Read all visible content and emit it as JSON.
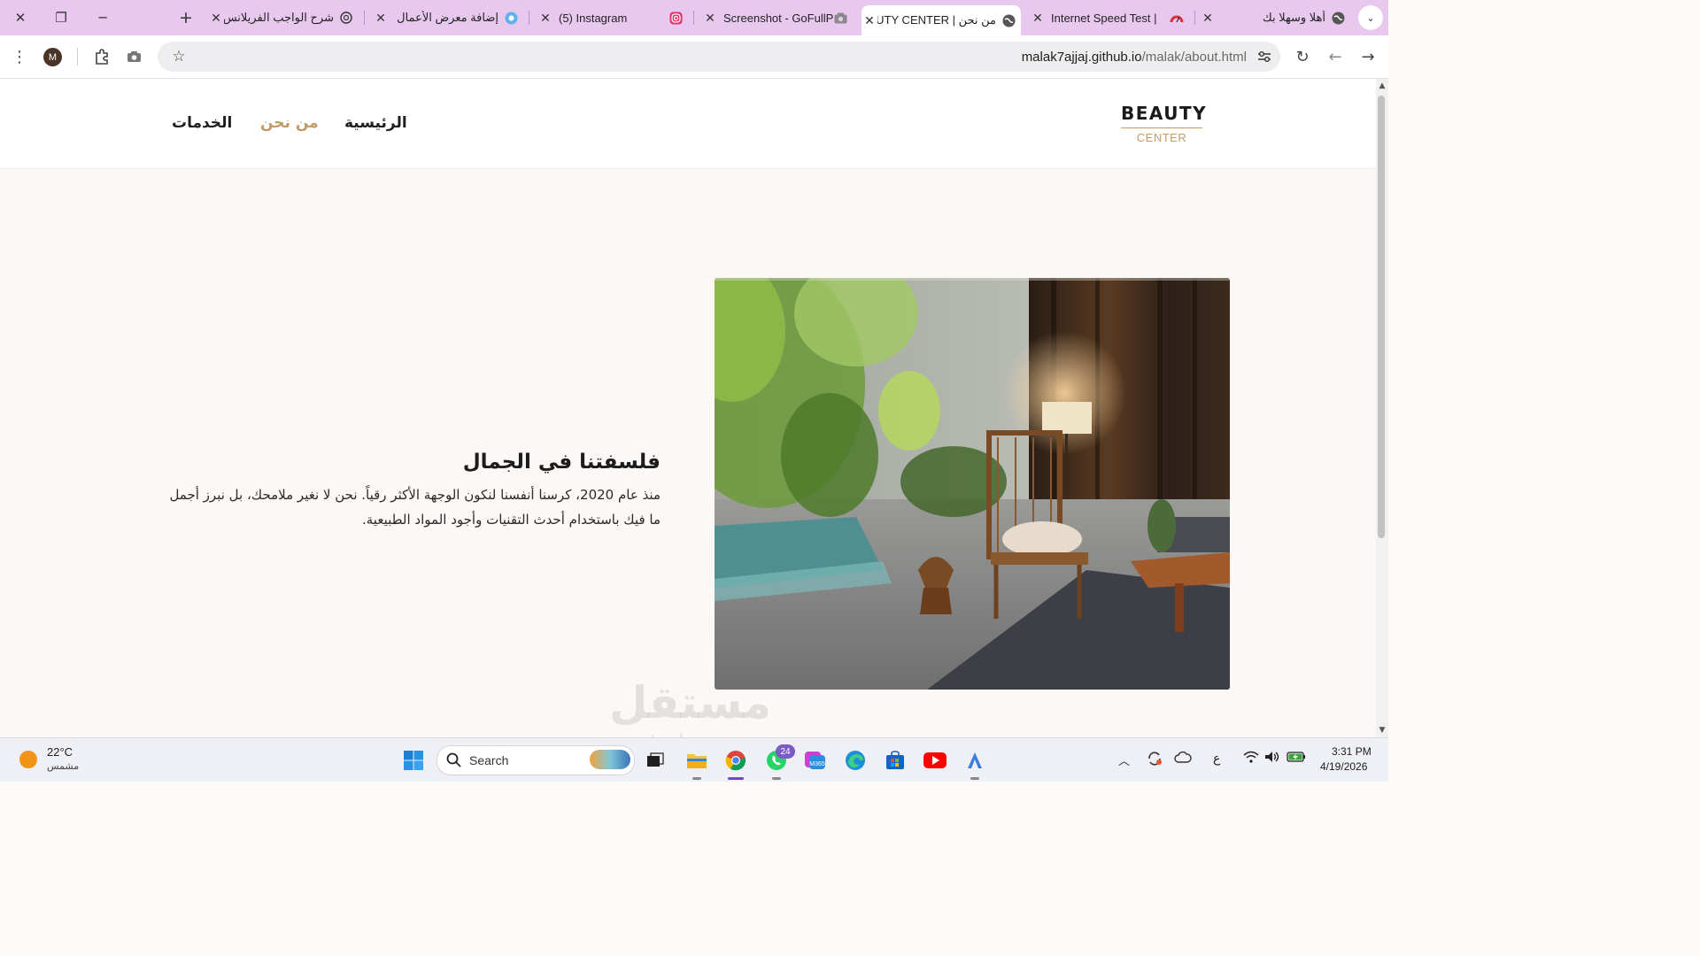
{
  "browser": {
    "tabs": [
      {
        "title": "أهلا وسهلا بك",
        "icon": "globe-icon",
        "active": false
      },
      {
        "title": "Internet Speed Test |",
        "icon": "speedometer-icon",
        "active": false
      },
      {
        "title": "من نحن | BEAUTY CENTER",
        "icon": "globe-icon",
        "active": true
      },
      {
        "title": "Screenshot - GoFullPage",
        "icon": "camera-icon",
        "active": false
      },
      {
        "title": "(5) Instagram",
        "icon": "instagram-icon",
        "active": false
      },
      {
        "title": "إضافة معرض الأعمال",
        "icon": "mostaql-icon",
        "active": false
      },
      {
        "title": "شرح الواجب الفريلانس",
        "icon": "chatgpt-icon",
        "active": false
      }
    ],
    "new_tab_label": "+",
    "url_host": "malak7ajjaj.github.io",
    "url_path": "/malak/about.html",
    "profile_initial": "M"
  },
  "site": {
    "logo_main": "BEAUTY",
    "logo_sub": "CENTER",
    "nav": [
      {
        "label": "الرئيسية",
        "active": false
      },
      {
        "label": "من نحن",
        "active": true
      },
      {
        "label": "الخدمات",
        "active": false
      }
    ],
    "section_title": "فلسفتنا في الجمال",
    "section_text": "منذ عام 2020، كرسنا أنفسنا لنكون الوجهة الأكثر رقياً. نحن لا نغير ملامحك، بل نبرز أجمل ما فيك باستخدام أحدث التقنيات وأجود المواد الطبيعية.",
    "watermark": "مستقل",
    "watermark_sub": "mostaql.com"
  },
  "taskbar": {
    "weather_temp": "22°C",
    "weather_desc": "مشمس",
    "search_label": "Search",
    "whatsapp_badge": "24",
    "tray_lang": "ع",
    "time": "3:31 PM",
    "date": "4/19/2026"
  },
  "colors": {
    "accent": "#c19a6b",
    "tab_strip": "#e9c8f0",
    "page_bg": "#fbf8f6"
  }
}
